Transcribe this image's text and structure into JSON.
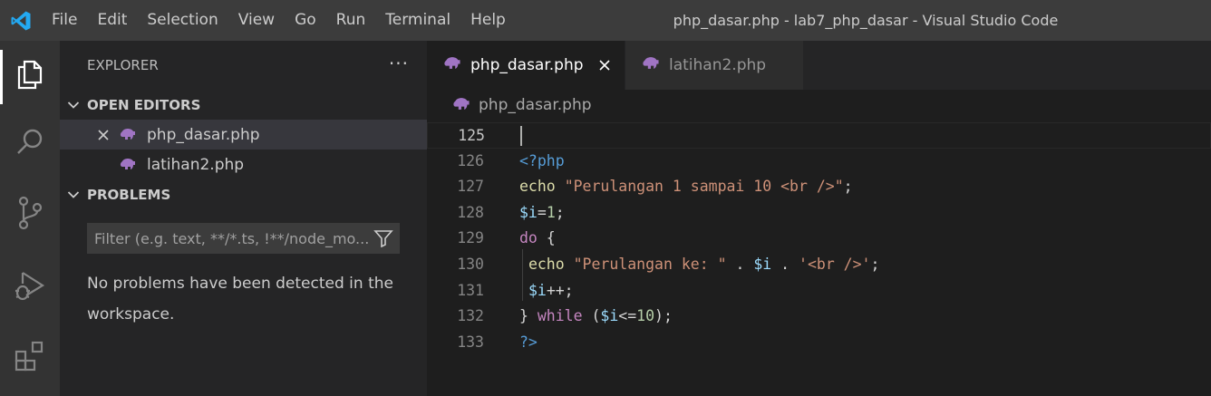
{
  "app": {
    "menu": [
      "File",
      "Edit",
      "Selection",
      "View",
      "Go",
      "Run",
      "Terminal",
      "Help"
    ],
    "window_title": "php_dasar.php - lab7_php_dasar - Visual Studio Code"
  },
  "sidebar": {
    "header": "EXPLORER",
    "more": "···",
    "open_editors": {
      "title": "OPEN EDITORS",
      "items": [
        {
          "label": "php_dasar.php",
          "selected": true
        },
        {
          "label": "latihan2.php",
          "selected": false
        }
      ]
    },
    "problems": {
      "title": "PROBLEMS",
      "filter_placeholder": "Filter (e.g. text, **/*.ts, !**/node_mo...",
      "message": "No problems have been detected in the workspace."
    }
  },
  "editor": {
    "tabs": [
      {
        "label": "php_dasar.php",
        "active": true
      },
      {
        "label": "latihan2.php",
        "active": false
      }
    ],
    "breadcrumb": "php_dasar.php",
    "lines": [
      {
        "number": "125",
        "tokens": []
      },
      {
        "number": "126",
        "tokens": [
          {
            "t": "<?php",
            "c": "kw-tag"
          }
        ]
      },
      {
        "number": "127",
        "tokens": [
          {
            "t": "echo",
            "c": "kw-fn"
          },
          {
            "t": " ",
            "c": "op"
          },
          {
            "t": "\"Perulangan 1 sampai 10 <br />\"",
            "c": "str"
          },
          {
            "t": ";",
            "c": "op"
          }
        ]
      },
      {
        "number": "128",
        "tokens": [
          {
            "t": "$i",
            "c": "var"
          },
          {
            "t": "=",
            "c": "op"
          },
          {
            "t": "1",
            "c": "num"
          },
          {
            "t": ";",
            "c": "op"
          }
        ]
      },
      {
        "number": "129",
        "tokens": [
          {
            "t": "do",
            "c": "kw-ctl"
          },
          {
            "t": " {",
            "c": "op"
          }
        ]
      },
      {
        "number": "130",
        "tokens": [
          {
            "t": " ",
            "c": "op"
          },
          {
            "t": "echo",
            "c": "kw-fn"
          },
          {
            "t": " ",
            "c": "op"
          },
          {
            "t": "\"Perulangan ke: \"",
            "c": "str"
          },
          {
            "t": " . ",
            "c": "op"
          },
          {
            "t": "$i",
            "c": "var"
          },
          {
            "t": " . ",
            "c": "op"
          },
          {
            "t": "'<br />'",
            "c": "str"
          },
          {
            "t": ";",
            "c": "op"
          }
        ]
      },
      {
        "number": "131",
        "tokens": [
          {
            "t": " ",
            "c": "op"
          },
          {
            "t": "$i",
            "c": "var"
          },
          {
            "t": "++;",
            "c": "op"
          }
        ]
      },
      {
        "number": "132",
        "tokens": [
          {
            "t": "} ",
            "c": "op"
          },
          {
            "t": "while",
            "c": "kw-ctl"
          },
          {
            "t": " (",
            "c": "op"
          },
          {
            "t": "$i",
            "c": "var"
          },
          {
            "t": "<=",
            "c": "op"
          },
          {
            "t": "10",
            "c": "num"
          },
          {
            "t": ");",
            "c": "op"
          }
        ]
      },
      {
        "number": "133",
        "tokens": [
          {
            "t": "?>",
            "c": "kw-tag"
          }
        ]
      }
    ]
  },
  "colors": {
    "php_icon": "#a074c4",
    "vscode_logo": "#23a9f2"
  }
}
